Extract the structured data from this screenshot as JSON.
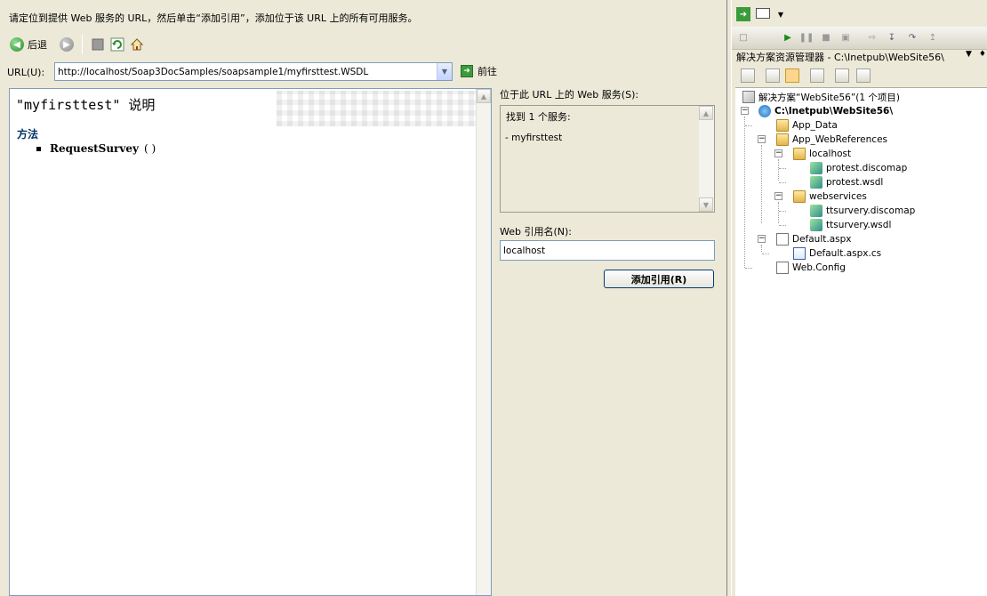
{
  "dialog": {
    "instruction": "请定位到提供 Web 服务的 URL，然后单击“添加引用”，添加位于该 URL 上的所有可用服务。",
    "toolbar": {
      "back_label": "后退",
      "icons": [
        "back-icon",
        "forward-icon",
        "stop-icon",
        "refresh-icon",
        "home-icon"
      ]
    },
    "url": {
      "label": "URL(U):",
      "value": "http://localhost/Soap3DocSamples/soapsample1/myfirsttest.WSDL",
      "go_label": "前往"
    },
    "browser": {
      "title": "\"myfirsttest\" 说明",
      "methods_heading": "方法",
      "methods": [
        {
          "name": "RequestSurvey",
          "args": "( )"
        }
      ]
    },
    "services": {
      "label": "位于此 URL 上的 Web 服务(S):",
      "found_text": "找到 1 个服务:",
      "items": [
        "- myfirsttest"
      ]
    },
    "web_ref": {
      "label": "Web 引用名(N):",
      "value": "localhost"
    },
    "add_reference_label": "添加引用(R)"
  },
  "solution_explorer": {
    "title": "解决方案资源管理器 - C:\\Inetpub\\WebSite56\\",
    "tree": [
      {
        "label": "解决方案“WebSite56”(1 个项目)",
        "icon": "solution-icon"
      },
      {
        "label": "C:\\Inetpub\\WebSite56\\",
        "icon": "website-icon",
        "bold": true
      },
      {
        "label": "App_Data",
        "icon": "folder-icon"
      },
      {
        "label": "App_WebReferences",
        "icon": "folder-open-icon"
      },
      {
        "label": "localhost",
        "icon": "folder-open-icon"
      },
      {
        "label": "protest.discomap",
        "icon": "discomap-icon"
      },
      {
        "label": "protest.wsdl",
        "icon": "wsdl-icon"
      },
      {
        "label": "webservices",
        "icon": "folder-open-icon"
      },
      {
        "label": "ttsurvery.discomap",
        "icon": "discomap-icon"
      },
      {
        "label": "ttsurvery.wsdl",
        "icon": "wsdl-icon"
      },
      {
        "label": "Default.aspx",
        "icon": "aspx-icon"
      },
      {
        "label": "Default.aspx.cs",
        "icon": "cs-file-icon"
      },
      {
        "label": "Web.Config",
        "icon": "config-icon"
      }
    ]
  }
}
